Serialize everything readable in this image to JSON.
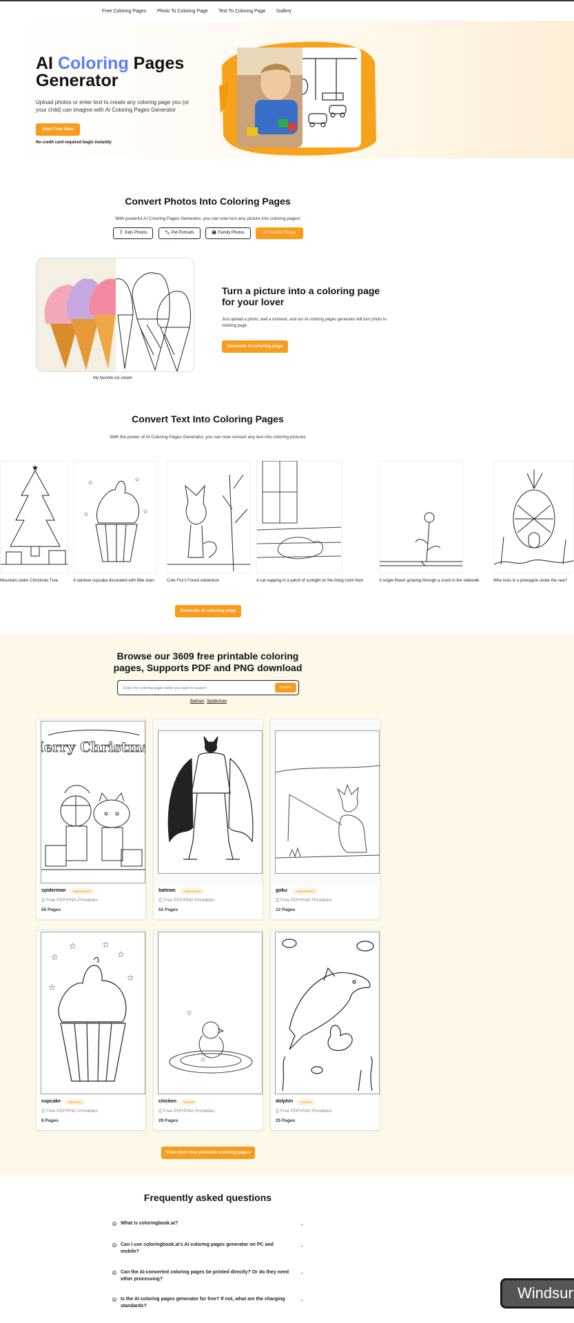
{
  "nav": {
    "links": [
      "Free Coloring Pages",
      "Photo To Coloring Page",
      "Text To Coloring Page",
      "Gallery"
    ]
  },
  "hero": {
    "title_part1": "AI ",
    "title_part2": "Coloring",
    "title_part3": " Pages",
    "title_line2": "Generator",
    "description": "Upload photos or enter text to create any coloring page you (or your child) can imagine with AI Coloring Pages Generator",
    "cta_label": "Start Free Now",
    "note": "No credit card required begin instantly"
  },
  "photos_section": {
    "title": "Convert Photos Into Coloring Pages",
    "subtitle": "With powerful AI Coloring Pages Generator, you can now turn any picture into coloring pages!",
    "chips": [
      "Kids Photos",
      "Pet Portraits",
      "Family Photos",
      "Favorite Things"
    ],
    "active_chip": 3,
    "image_caption": "My favorite ice cream",
    "feature_title": "Turn a picture into a coloring page for your lover",
    "feature_desc": "Just upload a photo, wait a moment, and our AI coloring pages generator will turn photo to coloring page",
    "feature_cta": "Generate AI coloring page"
  },
  "text_section": {
    "title": "Convert Text Into Coloring Pages",
    "subtitle": "With the power of AI Coloring Pages Generator, you can now convert any text into coloring pictures",
    "cards": [
      {
        "caption": "Mountain under Christmas Tree",
        "icon": "christmas-tree"
      },
      {
        "caption": "A rainbow cupcake decorated with little stars",
        "icon": "cupcake"
      },
      {
        "caption": "Cute Fox's Forest Adventure",
        "icon": "fox"
      },
      {
        "caption": "A cat napping in a patch of sunlight on the living room floor",
        "icon": "cat"
      },
      {
        "caption": "A single flower growing through a crack in the sidewalk",
        "icon": "flower"
      },
      {
        "caption": "Who lives in a pineapple under the sea?",
        "icon": "pineapple"
      }
    ],
    "cta": "Generate AI coloring page"
  },
  "browse": {
    "title_line1": "Browse our 3609 free printable coloring",
    "title_line2": "pages, Supports PDF and PNG download",
    "search_placeholder": "Enter the coloring page name you want to search",
    "search_button": "Search",
    "quick_links": [
      "Batman",
      "Spiderman"
    ],
    "cards": [
      {
        "name": "spiderman",
        "tag": "Superheroes",
        "printables": "Free PDF/PNG Printables",
        "pages": "55 Pages",
        "art_text": "Merry Christmas"
      },
      {
        "name": "batman",
        "tag": "Superheroes",
        "printables": "Free PDF/PNG Printables",
        "pages": "52 Pages"
      },
      {
        "name": "goku",
        "tag": "Superheroes",
        "printables": "Free PDF/PNG Printables",
        "pages": "12 Pages"
      },
      {
        "name": "cupcake",
        "tag": "Desserts",
        "printables": "Free PDF/PNG Printables",
        "pages": "8 Pages"
      },
      {
        "name": "chicken",
        "tag": "Animals",
        "printables": "Free PDF/PNG Printables",
        "pages": "29 Pages"
      },
      {
        "name": "dolphin",
        "tag": "Animals",
        "printables": "Free PDF/PNG Printables",
        "pages": "25 Pages"
      }
    ],
    "more_button": "View more free printable coloring pages"
  },
  "faq": {
    "title": "Frequently asked questions",
    "items": [
      "What is coloringbook.ai?",
      "Can I use coloringbook.ai's AI coloring pages generator on PC and mobile?",
      "Can the AI-converted coloring pages be printed directly? Or do they need other processing?",
      "Is the AI coloring pages generator for free? If not, what are the charging standards?"
    ]
  },
  "overlay": {
    "label": "Windsurf"
  },
  "colors": {
    "accent": "#f99b1c",
    "browse_bg": "#fdf8e7",
    "title_blue": "#5b7cff"
  }
}
